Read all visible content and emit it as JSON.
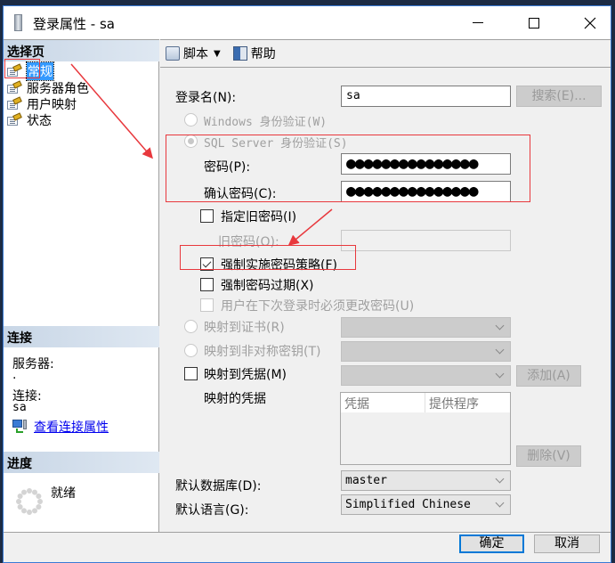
{
  "window": {
    "title": "登录属性 - sa",
    "controls": {
      "minimize": "minimize",
      "maximize": "maximize",
      "close": "close"
    }
  },
  "sidebar": {
    "select_page_header": "选择页",
    "pages": [
      {
        "label": "常规",
        "selected": true
      },
      {
        "label": "服务器角色",
        "selected": false
      },
      {
        "label": "用户映射",
        "selected": false
      },
      {
        "label": "状态",
        "selected": false
      }
    ],
    "connection_header": "连接",
    "server_label": "服务器:",
    "server_value": ".",
    "connection_label": "连接:",
    "connection_value": "sa",
    "view_connection_link": "查看连接属性",
    "progress_header": "进度",
    "progress_status": "就绪"
  },
  "toolbar": {
    "script_label": "脚本",
    "help_label": "帮助"
  },
  "form": {
    "login_name_label": "登录名(N):",
    "login_name_value": "sa",
    "search_button": "搜索(E)...",
    "windows_auth_label": "Windows 身份验证(W)",
    "sql_auth_label": "SQL Server 身份验证(S)",
    "password_label": "密码(P):",
    "password_value": "●●●●●●●●●●●●●●●",
    "confirm_password_label": "确认密码(C):",
    "confirm_password_value": "●●●●●●●●●●●●●●●",
    "specify_old_password_label": "指定旧密码(I)",
    "old_password_label": "旧密码(O):",
    "old_password_value": "",
    "enforce_policy_label": "强制实施密码策略(F)",
    "enforce_policy_checked": true,
    "enforce_expiration_label": "强制密码过期(X)",
    "enforce_expiration_checked": false,
    "must_change_label": "用户在下次登录时必须更改密码(U)",
    "map_certificate_label": "映射到证书(R)",
    "map_asymmetric_key_label": "映射到非对称密钥(T)",
    "map_credential_label": "映射到凭据(M)",
    "add_button": "添加(A)",
    "mapped_credentials_label": "映射的凭据",
    "credentials_columns": [
      "凭据",
      "提供程序"
    ],
    "remove_button": "删除(V)",
    "default_database_label": "默认数据库(D):",
    "default_database_value": "master",
    "default_language_label": "默认语言(G):",
    "default_language_value": "Simplified Chinese"
  },
  "footer": {
    "ok_button": "确定",
    "cancel_button": "取消"
  },
  "annotations": {
    "highlight_color": "#e8383d"
  }
}
